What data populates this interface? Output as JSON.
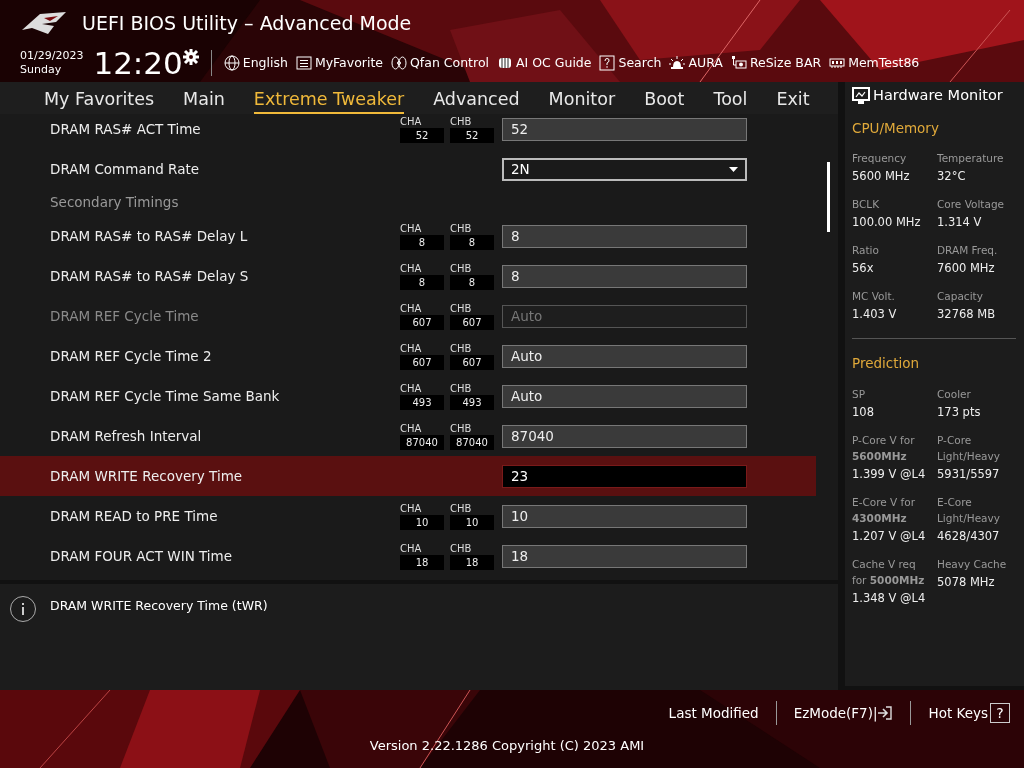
{
  "header": {
    "title": "UEFI BIOS Utility – Advanced Mode",
    "date": "01/29/2023",
    "day": "Sunday",
    "time": "12:20",
    "tools": [
      {
        "kind": "globe",
        "label": "English"
      },
      {
        "kind": "list",
        "label": "MyFavorite"
      },
      {
        "kind": "fan",
        "label": "Qfan Control"
      },
      {
        "kind": "chip",
        "label": "AI OC Guide"
      },
      {
        "kind": "question",
        "label": "Search"
      },
      {
        "kind": "light",
        "label": "AURA"
      },
      {
        "kind": "card",
        "label": "ReSize BAR"
      },
      {
        "kind": "memory",
        "label": "MemTest86"
      }
    ]
  },
  "tabs": [
    {
      "label": "My Favorites",
      "selected": false
    },
    {
      "label": "Main",
      "selected": false
    },
    {
      "label": "Extreme Tweaker",
      "selected": true
    },
    {
      "label": "Advanced",
      "selected": false
    },
    {
      "label": "Monitor",
      "selected": false
    },
    {
      "label": "Boot",
      "selected": false
    },
    {
      "label": "Tool",
      "selected": false
    },
    {
      "label": "Exit",
      "selected": false
    }
  ],
  "settings": [
    {
      "kind": "field",
      "label": "DRAM RAS# ACT Time",
      "channels": [
        {
          "label": "CHA",
          "value": "52"
        },
        {
          "label": "CHB",
          "value": "52"
        }
      ],
      "value": "52",
      "disabled": false,
      "selected": false
    },
    {
      "kind": "dropdown",
      "label": "DRAM Command Rate",
      "value": "2N",
      "disabled": false,
      "selected": false
    },
    {
      "kind": "heading",
      "label": "Secondary Timings"
    },
    {
      "kind": "field",
      "label": "DRAM RAS# to RAS# Delay L",
      "channels": [
        {
          "label": "CHA",
          "value": "8"
        },
        {
          "label": "CHB",
          "value": "8"
        }
      ],
      "value": "8",
      "disabled": false,
      "selected": false
    },
    {
      "kind": "field",
      "label": "DRAM RAS# to RAS# Delay S",
      "channels": [
        {
          "label": "CHA",
          "value": "8"
        },
        {
          "label": "CHB",
          "value": "8"
        }
      ],
      "value": "8",
      "disabled": false,
      "selected": false
    },
    {
      "kind": "field",
      "label": "DRAM REF Cycle Time",
      "channels": [
        {
          "label": "CHA",
          "value": "607"
        },
        {
          "label": "CHB",
          "value": "607"
        }
      ],
      "value": "Auto",
      "disabled": true,
      "selected": false
    },
    {
      "kind": "field",
      "label": "DRAM REF Cycle Time 2",
      "channels": [
        {
          "label": "CHA",
          "value": "607"
        },
        {
          "label": "CHB",
          "value": "607"
        }
      ],
      "value": "Auto",
      "disabled": false,
      "selected": false
    },
    {
      "kind": "field",
      "label": "DRAM REF Cycle Time Same Bank",
      "channels": [
        {
          "label": "CHA",
          "value": "493"
        },
        {
          "label": "CHB",
          "value": "493"
        }
      ],
      "value": "Auto",
      "disabled": false,
      "selected": false
    },
    {
      "kind": "field",
      "label": "DRAM Refresh Interval",
      "channels": [
        {
          "label": "CHA",
          "value": "87040"
        },
        {
          "label": "CHB",
          "value": "87040"
        }
      ],
      "value": "87040",
      "disabled": false,
      "selected": false
    },
    {
      "kind": "field",
      "label": "DRAM WRITE Recovery Time",
      "value": "23",
      "disabled": false,
      "selected": true
    },
    {
      "kind": "field",
      "label": "DRAM READ to PRE Time",
      "channels": [
        {
          "label": "CHA",
          "value": "10"
        },
        {
          "label": "CHB",
          "value": "10"
        }
      ],
      "value": "10",
      "disabled": false,
      "selected": false
    },
    {
      "kind": "field",
      "label": "DRAM FOUR ACT WIN Time",
      "channels": [
        {
          "label": "CHA",
          "value": "18"
        },
        {
          "label": "CHB",
          "value": "18"
        }
      ],
      "value": "18",
      "disabled": false,
      "selected": false
    }
  ],
  "help": "DRAM WRITE Recovery Time (tWR)",
  "hardware_monitor": {
    "title": "Hardware Monitor",
    "sections": [
      {
        "title": "CPU/Memory",
        "items": [
          {
            "label": "Frequency",
            "value": "5600 MHz"
          },
          {
            "label": "Temperature",
            "value": "32°C"
          },
          {
            "label": "BCLK",
            "value": "100.00 MHz"
          },
          {
            "label": "Core Voltage",
            "value": "1.314 V"
          },
          {
            "label": "Ratio",
            "value": "56x"
          },
          {
            "label": "DRAM Freq.",
            "value": "7600 MHz"
          },
          {
            "label": "MC Volt.",
            "value": "1.403 V"
          },
          {
            "label": "Capacity",
            "value": "32768 MB"
          }
        ]
      },
      {
        "title": "Prediction",
        "items": [
          {
            "label": "SP",
            "value": "108"
          },
          {
            "label": "Cooler",
            "value": "173 pts"
          },
          {
            "label": "P-Core V for **5600MHz**",
            "value": "1.399 V @L4"
          },
          {
            "label": "P-Core Light/Heavy",
            "value": "5931/5597"
          },
          {
            "label": "E-Core V for **4300MHz**",
            "value": "1.207 V @L4"
          },
          {
            "label": "E-Core Light/Heavy",
            "value": "4628/4307"
          },
          {
            "label": "Cache V req for **5000MHz**",
            "value": "1.348 V @L4"
          },
          {
            "label": "Heavy Cache",
            "value": "5078 MHz"
          }
        ]
      }
    ]
  },
  "footer": {
    "last_modified": "Last Modified",
    "ezmode": "EzMode(F7)|",
    "hot_keys": "Hot Keys",
    "hot_keys_key": "?",
    "version": "Version 2.22.1286 Copyright (C) 2023 AMI"
  }
}
